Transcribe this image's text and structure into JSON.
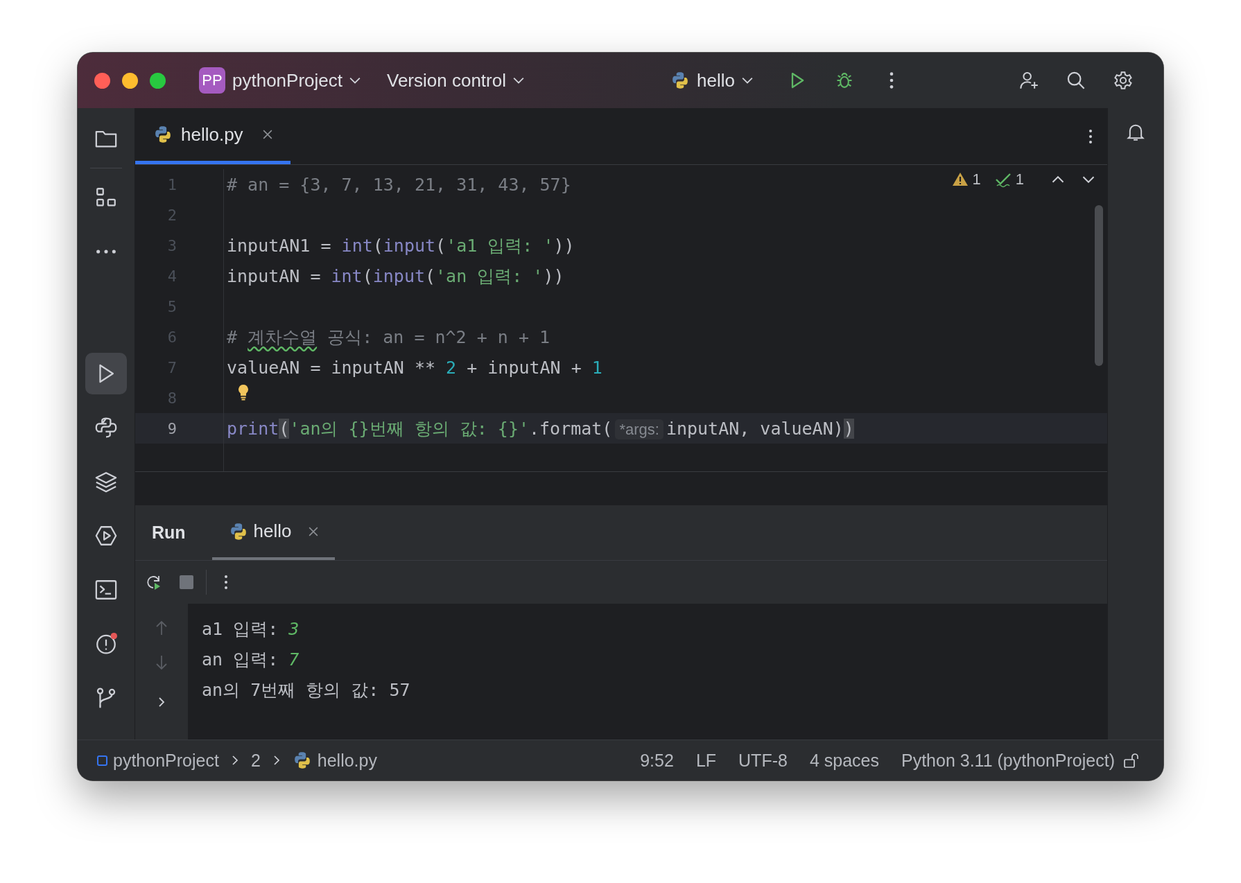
{
  "toolbar": {
    "project_badge": "PP",
    "project": "pythonProject",
    "vcs": "Version control",
    "run_config": "hello"
  },
  "sidebar": [
    {
      "kind": "folder",
      "selected": false,
      "alert": false
    },
    {
      "kind": "structure",
      "selected": false,
      "alert": false
    },
    {
      "kind": "more",
      "selected": false,
      "alert": false
    },
    {
      "kind": "run",
      "selected": true,
      "alert": false
    },
    {
      "kind": "python",
      "selected": false,
      "alert": false
    },
    {
      "kind": "layers",
      "selected": false,
      "alert": false
    },
    {
      "kind": "services",
      "selected": false,
      "alert": false
    },
    {
      "kind": "terminal",
      "selected": false,
      "alert": false
    },
    {
      "kind": "problems",
      "selected": false,
      "alert": true
    },
    {
      "kind": "git",
      "selected": false,
      "alert": false
    }
  ],
  "editor_tabs": [
    {
      "label": "hello.py",
      "selected": true
    }
  ],
  "inspections": {
    "warnings": "1",
    "typos": "1"
  },
  "code": [
    {
      "number": "1",
      "current": false,
      "bulb": false,
      "tokens": [
        {
          "t": "# an = {3, 7, 13, 21, 31, 43, 57}",
          "kind": "comment"
        }
      ]
    },
    {
      "number": "2",
      "current": false,
      "bulb": false
    },
    {
      "number": "3",
      "current": false,
      "bulb": false,
      "tokens": [
        {
          "t": "inputAN1 = ",
          "kind": "plain"
        },
        {
          "t": "int",
          "kind": "builtin"
        },
        {
          "t": "(",
          "kind": "plain"
        },
        {
          "t": "input",
          "kind": "builtin"
        },
        {
          "t": "(",
          "kind": "plain"
        },
        {
          "t": "'a1 입력: '",
          "kind": "string"
        },
        {
          "t": "))",
          "kind": "plain"
        }
      ]
    },
    {
      "number": "4",
      "current": false,
      "bulb": false,
      "tokens": [
        {
          "t": "inputAN = ",
          "kind": "plain"
        },
        {
          "t": "int",
          "kind": "builtin"
        },
        {
          "t": "(",
          "kind": "plain"
        },
        {
          "t": "input",
          "kind": "builtin"
        },
        {
          "t": "(",
          "kind": "plain"
        },
        {
          "t": "'an 입력: '",
          "kind": "string"
        },
        {
          "t": "))",
          "kind": "plain"
        }
      ]
    },
    {
      "number": "5",
      "current": false,
      "bulb": false
    },
    {
      "number": "6",
      "current": false,
      "bulb": false,
      "tokens": [
        {
          "t": "# ",
          "kind": "comment"
        },
        {
          "t": "계차수열",
          "kind": "typo"
        },
        {
          "t": " 공식: an = n^2 + n + 1",
          "kind": "comment"
        }
      ]
    },
    {
      "number": "7",
      "current": false,
      "bulb": false,
      "tokens": [
        {
          "t": "valueAN = inputAN ** ",
          "kind": "plain"
        },
        {
          "t": "2",
          "kind": "number"
        },
        {
          "t": " + inputAN + ",
          "kind": "plain"
        },
        {
          "t": "1",
          "kind": "number"
        }
      ]
    },
    {
      "number": "8",
      "current": false,
      "bulb": true
    },
    {
      "number": "9",
      "current": true,
      "bulb": false,
      "tokens": [
        {
          "t": "print",
          "kind": "builtin"
        },
        {
          "t": "(",
          "kind": "match"
        },
        {
          "t": "'an의 {}번째 항의 값: {}'",
          "kind": "string"
        },
        {
          "t": ".format(",
          "kind": "plain"
        },
        {
          "t": "*args:",
          "kind": "hint"
        },
        {
          "t": "inputAN, valueAN)",
          "kind": "plain"
        },
        {
          "t": ")",
          "kind": "match"
        }
      ]
    }
  ],
  "run_panel": {
    "title": "Run",
    "tabs": [
      {
        "label": "hello",
        "selected": true
      }
    ],
    "output": [
      {
        "tokens": [
          {
            "t": "a1 입력: ",
            "kind": "plain"
          },
          {
            "t": "3",
            "kind": "input"
          }
        ]
      },
      {
        "tokens": [
          {
            "t": "an 입력: ",
            "kind": "plain"
          },
          {
            "t": "7",
            "kind": "input"
          }
        ]
      },
      {
        "tokens": [
          {
            "t": "an의 7번째 항의 값: 57",
            "kind": "plain"
          }
        ]
      }
    ]
  },
  "status_bar": {
    "breadcrumbs": [
      "pythonProject",
      "2",
      "hello.py"
    ],
    "items": [
      "9:52",
      "LF",
      "UTF-8",
      "4 spaces",
      "Python 3.11 (pythonProject)"
    ]
  }
}
